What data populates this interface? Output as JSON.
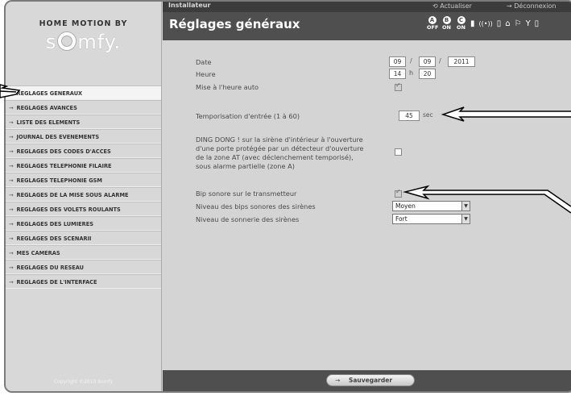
{
  "header": {
    "role": "Installateur",
    "refresh_label": "Actualiser",
    "logout_label": "Déconnexion",
    "page_title": "Réglages généraux",
    "zones": [
      {
        "letter": "A",
        "state": "OFF"
      },
      {
        "letter": "B",
        "state": "ON"
      },
      {
        "letter": "C",
        "state": "ON"
      }
    ]
  },
  "brand": {
    "top": "HOME MOTION BY",
    "logo": "somfy"
  },
  "sidebar": {
    "items": [
      {
        "label": "REGLAGES GENERAUX"
      },
      {
        "label": "REGLAGES AVANCES"
      },
      {
        "label": "LISTE DES ELEMENTS"
      },
      {
        "label": "JOURNAL DES EVENEMENTS"
      },
      {
        "label": "REGLAGES DES CODES D'ACCES"
      },
      {
        "label": "REGLAGES TELEPHONIE FILAIRE"
      },
      {
        "label": "REGLAGES TELEPHONIE GSM"
      },
      {
        "label": "REGLAGES DE LA MISE SOUS ALARME"
      },
      {
        "label": "REGLAGES DES VOLETS ROULANTS"
      },
      {
        "label": "REGLAGES DES LUMIERES"
      },
      {
        "label": "REGLAGES DES SCENARII"
      },
      {
        "label": "MES CAMERAS"
      },
      {
        "label": "REGLAGES DU RESEAU"
      },
      {
        "label": "REGLAGES DE L'INTERFACE"
      }
    ],
    "copyright": "Copyright ©2010 Somfy"
  },
  "form": {
    "date_label": "Date",
    "date_day": "09",
    "date_month": "09",
    "date_year": "2011",
    "date_sep": "/",
    "time_label": "Heure",
    "time_hour": "14",
    "time_sep": "h",
    "time_min": "20",
    "auto_time_label": "Mise à l'heure auto",
    "auto_time_checked": true,
    "entry_delay_label": "Temporisation d'entrée (1 à 60)",
    "entry_delay_value": "45",
    "entry_delay_unit": "sec",
    "dingdong_lines": [
      "DING DONG ! sur la sirène d'intérieur à l'ouverture",
      "d'une porte protégée par un détecteur d'ouverture",
      "de la zone AT (avec déclenchement temporisé),",
      "sous alarme partielle (zone A)"
    ],
    "dingdong_checked": false,
    "bip_label": "Bip sonore sur le transmetteur",
    "bip_checked": true,
    "siren_bip_label": "Niveau des bips sonores des sirènes",
    "siren_bip_value": "Moyen",
    "siren_ring_label": "Niveau de sonnerie des sirènes",
    "siren_ring_value": "Fort"
  },
  "footer": {
    "save_label": "Sauvegarder"
  }
}
